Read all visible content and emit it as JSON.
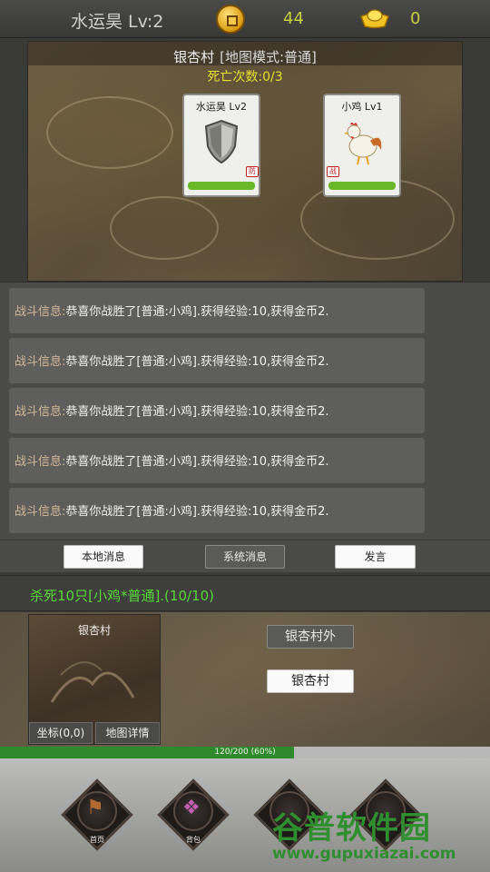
{
  "player": {
    "name_level": "水运昊 Lv:2"
  },
  "currency": {
    "gold": "44",
    "ingot": "0"
  },
  "map": {
    "title": "银杏村",
    "mode": "[地图模式:普通]",
    "death_count": "死亡次数:0/3"
  },
  "battle": {
    "player_card": {
      "name": "水运昊 Lv2",
      "tag": "防",
      "hp_fraction": 1.0
    },
    "enemy_card": {
      "name": "小鸡 Lv1",
      "tag": "战",
      "hp_fraction": 1.0
    }
  },
  "messages": [
    {
      "prefix": "战斗信息:",
      "text": "恭喜你战胜了[普通:小鸡].获得经验:10,获得金币2."
    },
    {
      "prefix": "战斗信息:",
      "text": "恭喜你战胜了[普通:小鸡].获得经验:10,获得金币2."
    },
    {
      "prefix": "战斗信息:",
      "text": "恭喜你战胜了[普通:小鸡].获得经验:10,获得金币2."
    },
    {
      "prefix": "战斗信息:",
      "text": "恭喜你战胜了[普通:小鸡].获得经验:10,获得金币2."
    },
    {
      "prefix": "战斗信息:",
      "text": "恭喜你战胜了[普通:小鸡].获得经验:10,获得金币2."
    }
  ],
  "message_tabs": {
    "local": "本地消息",
    "system": "系统消息",
    "speak": "发言"
  },
  "quest": {
    "text": "杀死10只[小鸡*普通].(10/10)"
  },
  "area": {
    "minimap_title": "银杏村",
    "coord_label": "坐标(0,0)",
    "map_detail_label": "地图详情",
    "exits": [
      "银杏村外",
      "银杏村"
    ]
  },
  "exp": {
    "text": "120/200 (60%)",
    "fraction": 0.6
  },
  "nav": [
    {
      "label": "首页",
      "icon": "signpost-icon"
    },
    {
      "label": "背包",
      "icon": "bag-icon"
    },
    {
      "label": "",
      "icon": "nav-icon-3"
    },
    {
      "label": "",
      "icon": "nav-icon-4"
    }
  ],
  "watermark": {
    "title": "谷普软件园",
    "url": "www.gupuxiazai.com"
  },
  "colors": {
    "quest_green": "#58d838",
    "gold_text": "#c8d040",
    "exp_fill": "#2e8a2a",
    "hp_green": "#6ab82a"
  }
}
